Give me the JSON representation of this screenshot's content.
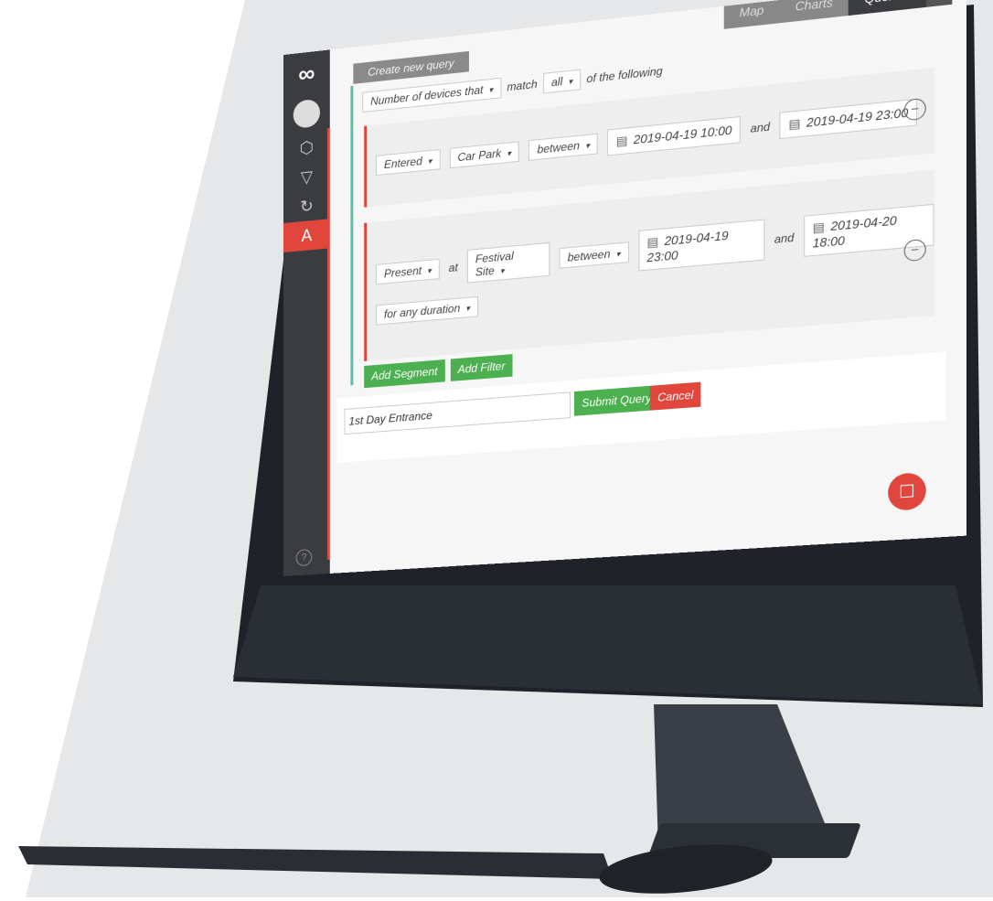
{
  "nav": {
    "tabs": [
      "Map",
      "Charts",
      "Queries"
    ],
    "active": "Queries"
  },
  "create_tab": "Create new query",
  "match": {
    "subject": "Number of devices that",
    "match_label": "match",
    "mode": "all",
    "suffix": "of the following"
  },
  "segments": [
    {
      "action": "Entered",
      "location": "Car Park",
      "range": "between",
      "start": "2019-04-19 10:00",
      "and_label": "and",
      "end": "2019-04-19 23:00"
    },
    {
      "action": "Present",
      "at_label": "at",
      "location": "Festival Site",
      "range": "between",
      "start": "2019-04-19 23:00",
      "and_label": "and",
      "end": "2019-04-20 18:00",
      "duration": "for any duration"
    }
  ],
  "actions": {
    "add_segment": "Add Segment",
    "add_filter": "Add Filter"
  },
  "save": {
    "name": "1st Day Entrance",
    "submit": "Submit Query",
    "cancel": "Cancel"
  },
  "icons": {
    "logo": "infinity-icon",
    "user": "user-avatar-icon",
    "hex": "hexagon-icon",
    "triangle": "triangle-icon",
    "refresh": "refresh-icon",
    "analytics": "a-icon",
    "help": "help-icon",
    "chat": "chat-icon",
    "settings": "gear-icon"
  },
  "colors": {
    "accent_red": "#e0463c",
    "green": "#4caf50",
    "teal": "#5bc0a6"
  }
}
